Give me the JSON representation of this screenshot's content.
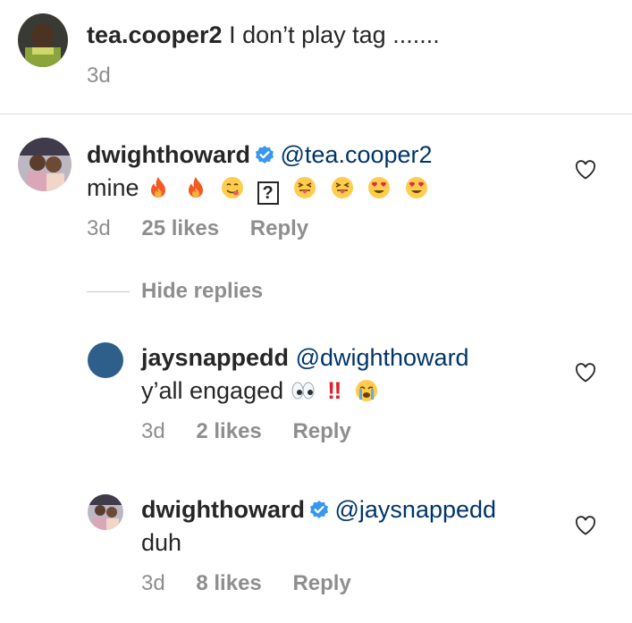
{
  "comment1": {
    "username": "tea.cooper2",
    "text": "I don’t play tag .......",
    "time": "3d"
  },
  "comment2": {
    "username": "dwighthoward",
    "mention": "@tea.cooper2",
    "text": "mine",
    "time": "3d",
    "likes": "25 likes",
    "reply": "Reply"
  },
  "hide_replies": "Hide replies",
  "reply1": {
    "username": "jaysnappedd",
    "mention": "@dwighthoward",
    "text": "y’all engaged",
    "missing_glyph": "?",
    "bangs": "‼",
    "time": "3d",
    "likes": "2 likes",
    "reply": "Reply"
  },
  "reply2": {
    "username": "dwighthoward",
    "mention": "@jaysnappedd",
    "text": "duh",
    "time": "3d",
    "likes": "8 likes",
    "reply": "Reply"
  },
  "colors": {
    "mention": "#003569",
    "meta": "#8e8e8e",
    "verified": "#3897f0",
    "divider": "#dbdbdb"
  }
}
